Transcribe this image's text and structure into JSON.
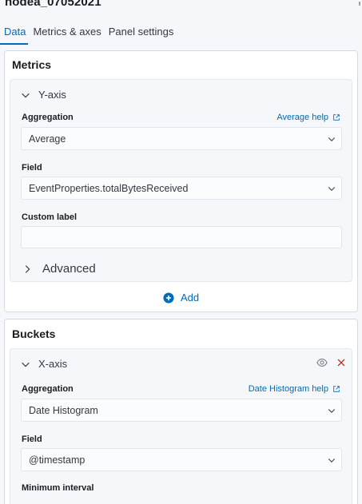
{
  "index_title": "nodea_07052021",
  "tabs": [
    {
      "label": "Data",
      "active": true
    },
    {
      "label": "Metrics & axes",
      "active": false
    },
    {
      "label": "Panel settings",
      "active": false
    }
  ],
  "metrics": {
    "title": "Metrics",
    "y_axis": {
      "header": "Y-axis",
      "aggregation_label": "Aggregation",
      "aggregation_help": "Average help",
      "aggregation_value": "Average",
      "field_label": "Field",
      "field_value": "EventProperties.totalBytesReceived",
      "custom_label_label": "Custom label",
      "custom_label_value": "",
      "advanced_label": "Advanced"
    },
    "add_label": "Add"
  },
  "buckets": {
    "title": "Buckets",
    "x_axis": {
      "header": "X-axis",
      "aggregation_label": "Aggregation",
      "aggregation_help": "Date Histogram help",
      "aggregation_value": "Date Histogram",
      "field_label": "Field",
      "field_value": "@timestamp",
      "min_interval_label": "Minimum interval"
    }
  },
  "icons": {
    "chevron_down": "chevron-down-icon",
    "chevron_right": "chevron-right-icon",
    "external_link": "external-link-icon",
    "plus_circle": "plus-circle-icon",
    "eye": "eye-icon",
    "close": "close-icon"
  },
  "colors": {
    "accent": "#006bb8",
    "danger": "#bd271e",
    "text": "#1a1c21",
    "subdued": "#343741",
    "panel_bg": "#ffffff",
    "page_bg": "#f5f7fa",
    "border": "#d3dae6"
  }
}
